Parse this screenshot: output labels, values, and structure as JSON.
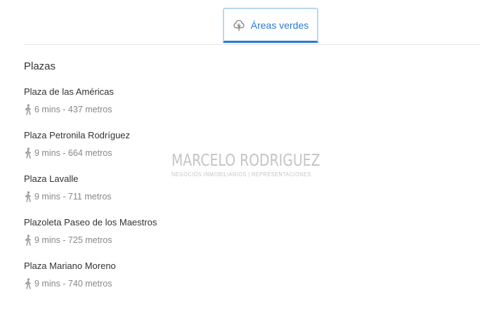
{
  "tabs": [
    {
      "label": "Áreas verdes",
      "icon": "tree-icon",
      "active": true
    }
  ],
  "section": {
    "title": "Plazas",
    "items": [
      {
        "name": "Plaza de las Américas",
        "walk": "6 mins - 437 metros"
      },
      {
        "name": "Plaza Petronila Rodríguez",
        "walk": "9 mins - 664 metros"
      },
      {
        "name": "Plaza Lavalle",
        "walk": "9 mins - 711 metros"
      },
      {
        "name": "Plazoleta Paseo de los Maestros",
        "walk": "9 mins - 725 metros"
      },
      {
        "name": "Plaza Mariano Moreno",
        "walk": "9 mins - 740 metros"
      }
    ]
  },
  "watermark": {
    "name": "MARCELO RODRIGUEZ",
    "tagline": "NEGOCIOS INMOBILIARIOS | REPRESENTACIONES"
  },
  "colors": {
    "accent": "#2a7bd3",
    "tab_border": "#b9d7f0",
    "text": "#333333",
    "muted": "#888888",
    "watermark": "#c4c4c4"
  }
}
